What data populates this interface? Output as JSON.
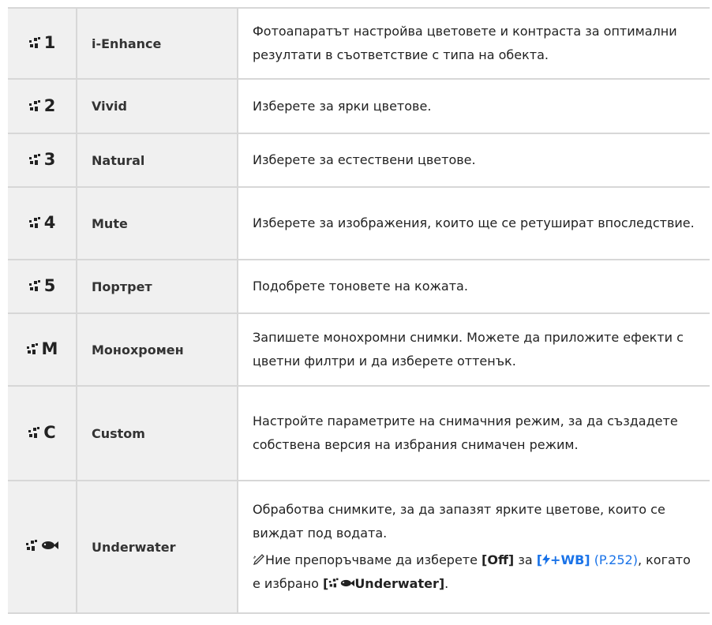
{
  "rows": [
    {
      "mode": "1",
      "name": "i-Enhance",
      "desc": "Фотоапаратът настройва цветовете и контраста за оптимални резултати в съответствие с типа на обекта."
    },
    {
      "mode": "2",
      "name": "Vivid",
      "desc": "Изберете за ярки цветове."
    },
    {
      "mode": "3",
      "name": "Natural",
      "desc": "Изберете за естествени цветове."
    },
    {
      "mode": "4",
      "name": "Mute",
      "desc": "Изберете за изображения, които ще се ретушират впоследствие."
    },
    {
      "mode": "5",
      "name": "Портрет",
      "desc": "Подобрете тоновете на кожата."
    },
    {
      "mode": "M",
      "name": "Монохромен",
      "desc": "Запишете монохромни снимки. Можете да приложите ефекти с цветни филтри и да изберете оттенък."
    },
    {
      "mode": "C",
      "name": "Custom",
      "desc": "Настройте параметрите на снимачния режим, за да създадете собствена версия на избрания снимачен режим."
    },
    {
      "mode": "",
      "name": "Underwater",
      "desc": "Обработва снимките, за да запазят ярките цветове, които се виждат под водата."
    }
  ],
  "note": {
    "text1": "Ние препоръчваме да изберете ",
    "off": "[Off]",
    "text2": " за ",
    "flash_open": "[",
    "flash_wb": "+WB]",
    "page_ref": "(P.252)",
    "text3": ", когато е избрано ",
    "open_bracket": "[",
    "underwater_label": "Underwater]",
    "text4": "."
  },
  "colors": {
    "link": "#1a73e8",
    "cell_bg": "#f0f0f0",
    "border": "#d7d7d7"
  }
}
